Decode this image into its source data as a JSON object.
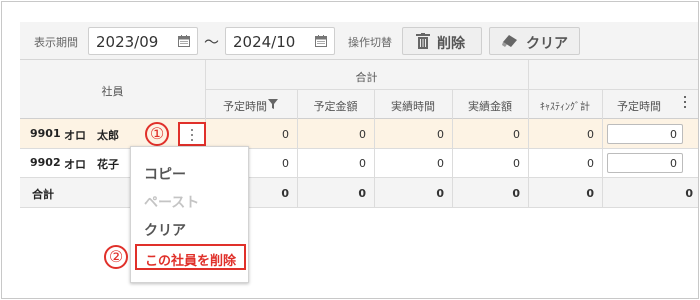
{
  "toolbar": {
    "period_label": "表示期間",
    "date_from": "2023/09",
    "tilde": "～",
    "date_to": "2024/10",
    "mode_label": "操作切替",
    "delete_label": "削除",
    "clear_label": "クリア"
  },
  "table": {
    "employee_header": "社員",
    "total_group_header": "合計",
    "columns": [
      "予定時間",
      "予定金額",
      "実績時間",
      "実績金額",
      "ｷｬｽﾃｨﾝｸﾞ計",
      "予定時間"
    ],
    "rows": [
      {
        "code": "9901",
        "name": "オロ　太郎",
        "values": [
          "0",
          "0",
          "0",
          "0",
          "0",
          "0"
        ]
      },
      {
        "code": "9902",
        "name": "オロ　花子",
        "values": [
          "0",
          "0",
          "0",
          "0",
          "0",
          "0"
        ]
      }
    ],
    "total_row": {
      "label": "合計",
      "values": [
        "0",
        "0",
        "0",
        "0",
        "0",
        "0"
      ]
    }
  },
  "context_menu": {
    "items": [
      "コピー",
      "ペースト",
      "クリア",
      "この社員を削除"
    ]
  },
  "callouts": [
    "①",
    "②"
  ],
  "colors": {
    "accent_red": "#e0302a",
    "highlight_row": "#fdf3e4"
  }
}
